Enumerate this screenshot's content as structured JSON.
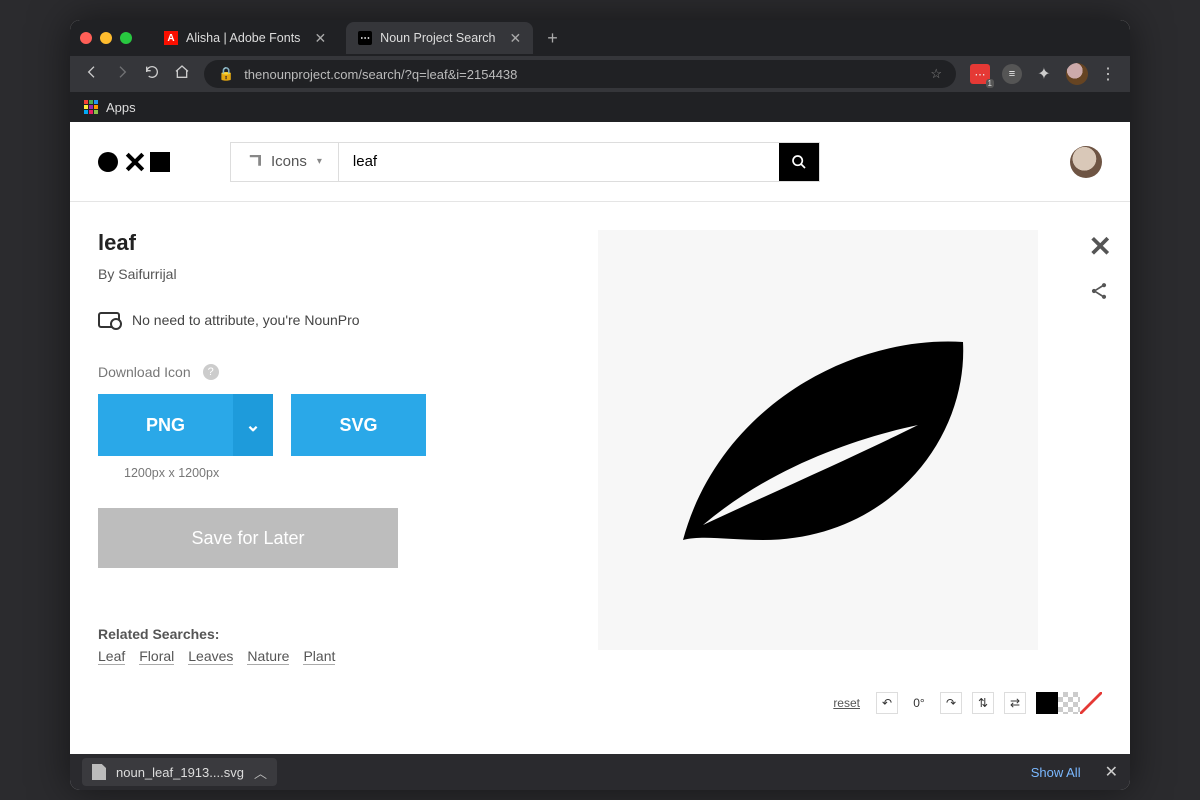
{
  "chrome": {
    "tabs": [
      {
        "title": "Alisha | Adobe Fonts"
      },
      {
        "title": "Noun Project Search"
      }
    ],
    "url": "thenounproject.com/search/?q=leaf&i=2154438",
    "apps_label": "Apps",
    "ext_badge": "1"
  },
  "search": {
    "dropdown": "Icons",
    "value": "leaf"
  },
  "icon": {
    "title": "leaf",
    "author": "By Saifurrijal",
    "attribution": "No need to attribute, you're NounPro",
    "download_label": "Download Icon",
    "png_label": "PNG",
    "svg_label": "SVG",
    "png_size": "1200px x 1200px",
    "save_label": "Save for Later"
  },
  "related": {
    "heading": "Related Searches:",
    "tags": [
      "Leaf",
      "Floral",
      "Leaves",
      "Nature",
      "Plant"
    ]
  },
  "editor": {
    "reset": "reset",
    "rotation": "0°"
  },
  "downloads": {
    "filename": "noun_leaf_1913....svg",
    "show_all": "Show All"
  }
}
